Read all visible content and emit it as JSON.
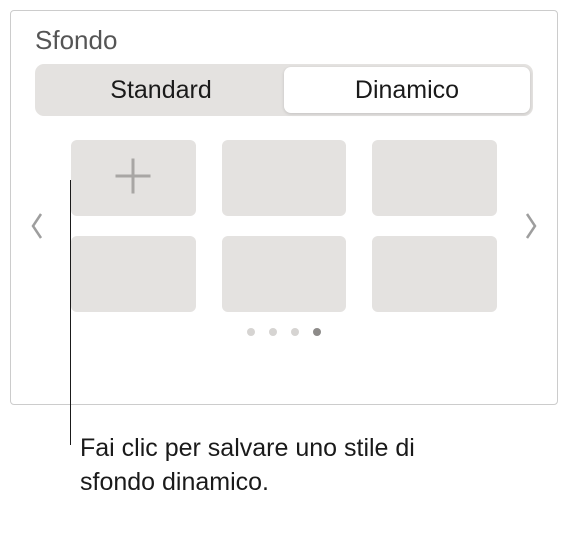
{
  "section": {
    "title": "Sfondo"
  },
  "tabs": {
    "standard": "Standard",
    "dinamico": "Dinamico",
    "active": "dinamico"
  },
  "carousel": {
    "pages": 4,
    "activePage": 3
  },
  "callout": "Fai clic per salvare uno stile di sfondo dinamico."
}
